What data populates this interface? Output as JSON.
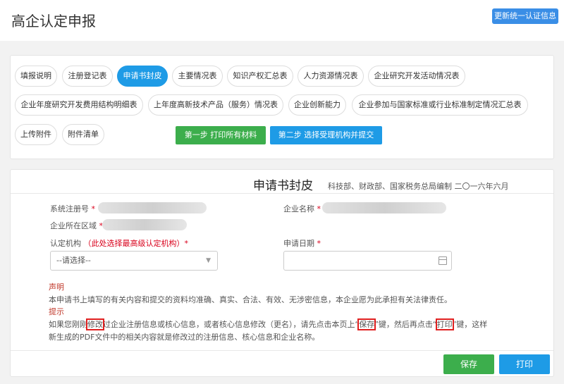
{
  "header": {
    "title": "高企认定申报",
    "update_button": "更新统一认证信息"
  },
  "tabs": [
    {
      "label": "填报说明"
    },
    {
      "label": "注册登记表"
    },
    {
      "label": "申请书封皮",
      "active": true
    },
    {
      "label": "主要情况表"
    },
    {
      "label": "知识产权汇总表"
    },
    {
      "label": "人力资源情况表"
    },
    {
      "label": "企业研究开发活动情况表"
    },
    {
      "label": "企业年度研究开发费用结构明细表"
    },
    {
      "label": "上年度高新技术产品（服务）情况表"
    },
    {
      "label": "企业创新能力"
    },
    {
      "label": "企业参加与国家标准或行业标准制定情况汇总表"
    },
    {
      "label": "上传附件"
    },
    {
      "label": "附件清单"
    }
  ],
  "steps": {
    "step1": "第一步 打印所有材料",
    "step2": "第二步 选择受理机构并提交"
  },
  "form": {
    "title": "申请书封皮",
    "subtitle": "科技部、财政部、国家税务总局编制 二〇一六年六月",
    "reg_no_label": "系统注册号",
    "company_label": "企业名称",
    "region_label": "企业所在区域",
    "authority_label": "认定机构",
    "authority_hint": "（此处选择最高级认定机构）",
    "authority_placeholder": "--请选择--",
    "date_label": "申请日期",
    "required_mark": "*"
  },
  "notice": {
    "statement_title": "声明",
    "statement_text": "本申请书上填写的有关内容和提交的资料均准确、真实、合法、有效、无涉密信息，本企业愿为此承担有关法律责任。",
    "tip_title": "提示",
    "tip_p1": "如果您刚刚",
    "tip_hl1": "修改",
    "tip_p2": "过企业注册信息或核心信息，或者核心信息修改（更名），请先点击本页上“",
    "tip_hl2": "保存",
    "tip_p3": "”键，然后再点击“",
    "tip_hl3": "打印",
    "tip_p4": "”键，这样",
    "tip_line2": "新生成的PDF文件中的相关内容就是修改过的注册信息、核心信息和企业名称。"
  },
  "actions": {
    "save": "保存",
    "print": "打印"
  },
  "colors": {
    "primary_blue": "#1e9be6",
    "green": "#3cae4c",
    "required_red": "#d9001b"
  }
}
